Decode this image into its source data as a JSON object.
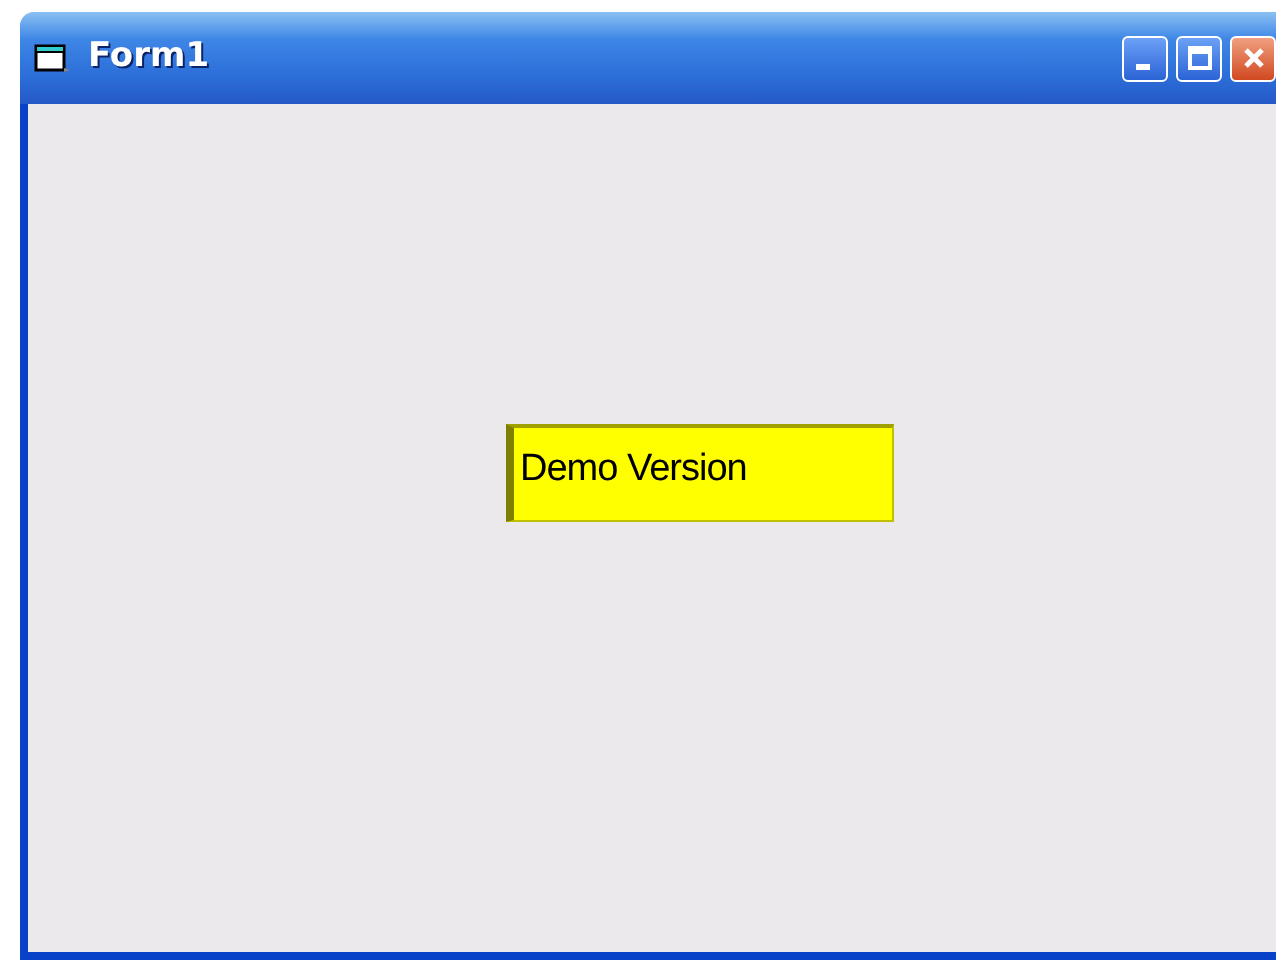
{
  "window": {
    "title": "Form1"
  },
  "label": {
    "text": "Demo Version"
  }
}
